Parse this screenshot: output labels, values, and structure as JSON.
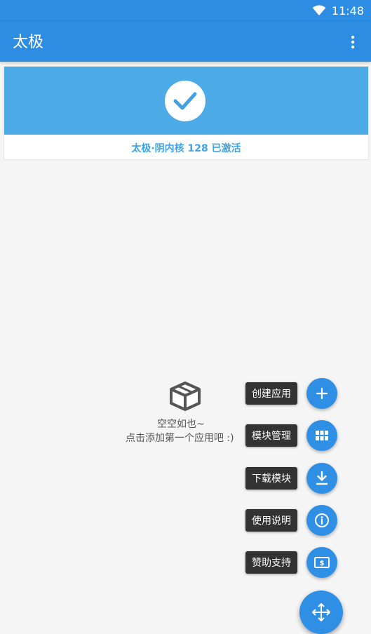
{
  "status_bar": {
    "time": "11:48",
    "wifi_icon": "wifi-icon"
  },
  "app_bar": {
    "title": "太极",
    "menu_icon": "more-vert-icon"
  },
  "status_card": {
    "icon": "check-icon",
    "text": "太极·阴内核 128 已激活",
    "banner_color": "#4caae6",
    "text_color": "#3fa2e4"
  },
  "empty_state": {
    "icon": "box-icon",
    "title": "空空如也~",
    "subtitle": "点击添加第一个应用吧 :)"
  },
  "fab_menu": {
    "items": [
      {
        "label": "创建应用",
        "icon": "plus-icon"
      },
      {
        "label": "模块管理",
        "icon": "grid-icon"
      },
      {
        "label": "下载模块",
        "icon": "download-icon"
      },
      {
        "label": "使用说明",
        "icon": "info-icon"
      },
      {
        "label": "赞助支持",
        "icon": "money-icon"
      }
    ],
    "main_icon": "move-arrows-icon",
    "color": "#2f8fe5"
  }
}
